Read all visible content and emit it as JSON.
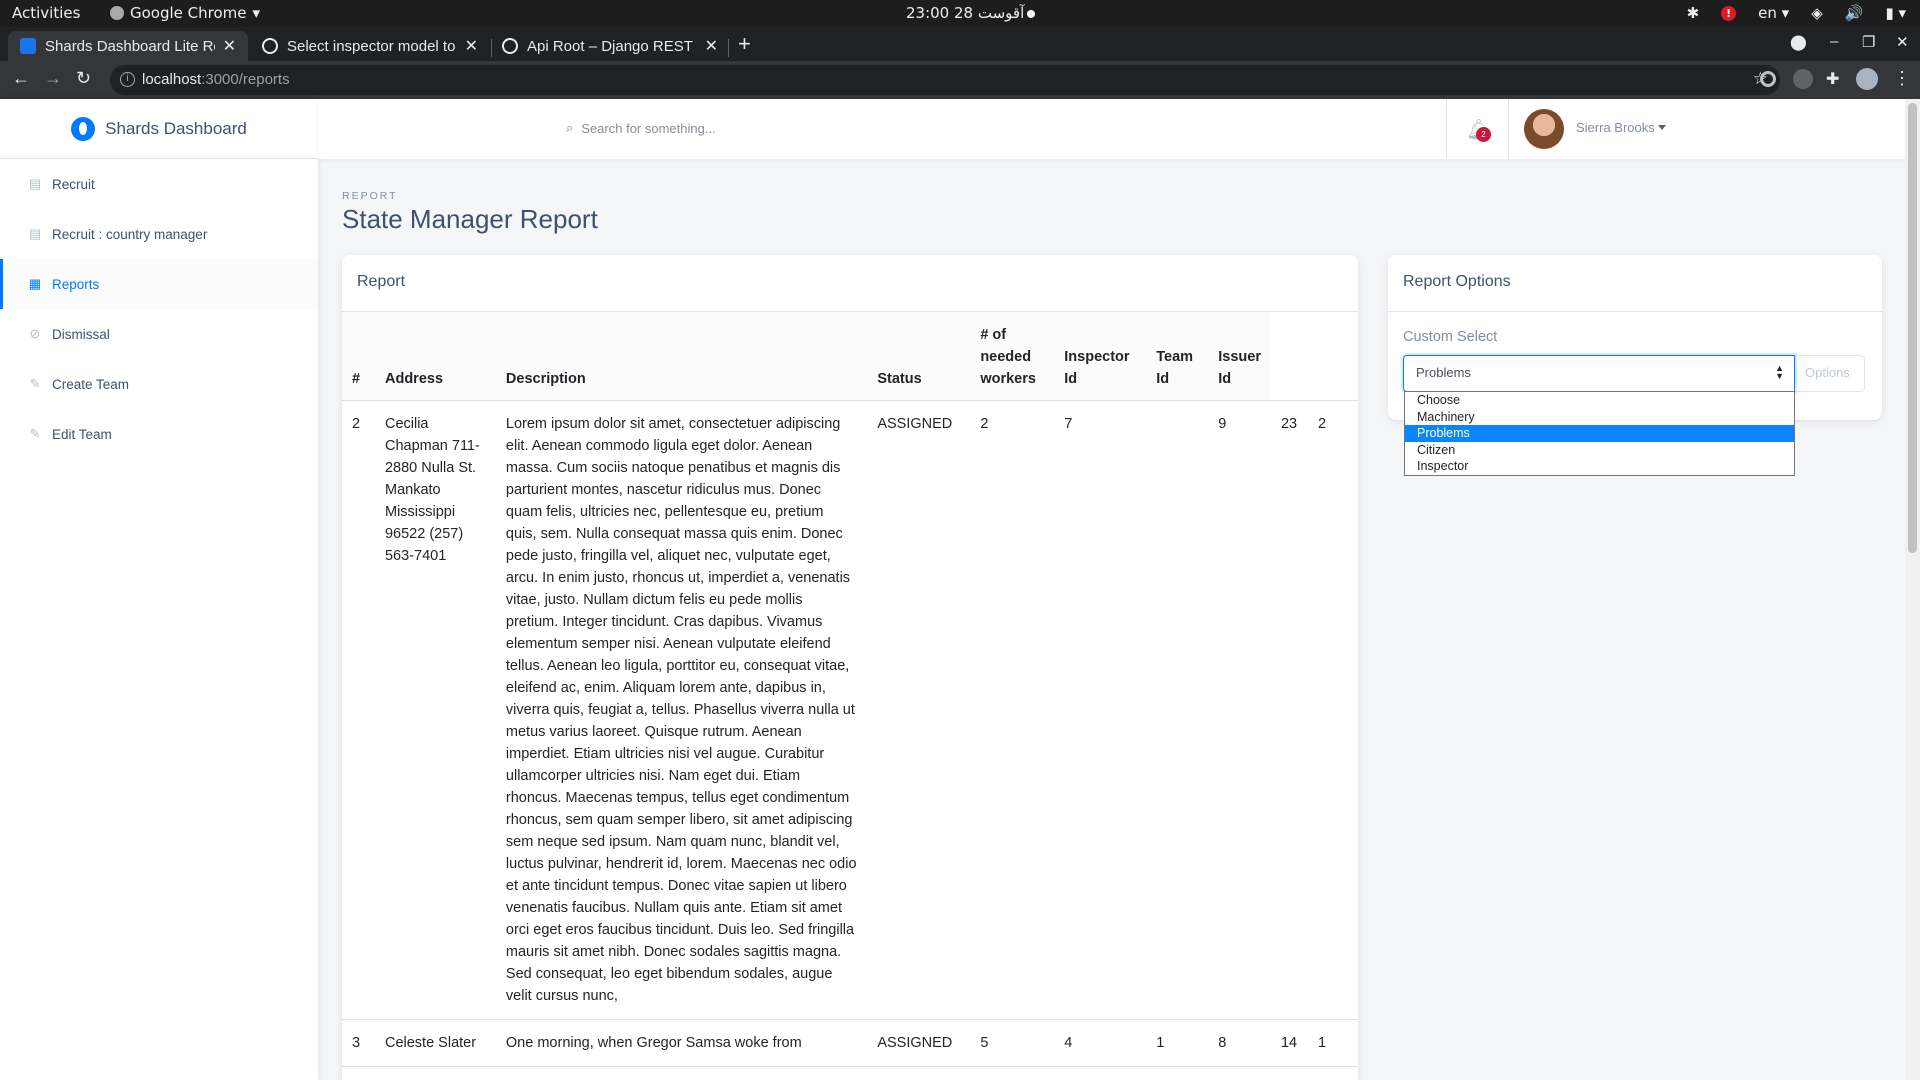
{
  "os": {
    "activities": "Activities",
    "app_name": "Google Chrome",
    "clock": "23:00  28 آقوست",
    "lang": "en"
  },
  "browser": {
    "tabs": [
      {
        "title": "Shards Dashboard Lite Re"
      },
      {
        "title": "Select inspector model to"
      },
      {
        "title": "Api Root – Django REST fr"
      }
    ],
    "url_host": "localhost",
    "url_path": ":3000/reports"
  },
  "sidebar": {
    "brand": "Shards Dashboard",
    "items": [
      {
        "label": "Recruit",
        "icon": "file-icon"
      },
      {
        "label": "Recruit : country manager",
        "icon": "file-icon"
      },
      {
        "label": "Reports",
        "icon": "grid-icon"
      },
      {
        "label": "Dismissal",
        "icon": "block-icon"
      },
      {
        "label": "Create Team",
        "icon": "pencil-icon"
      },
      {
        "label": "Edit Team",
        "icon": "pencil-icon"
      }
    ]
  },
  "topnav": {
    "search_placeholder": "Search for something...",
    "notifications": "2",
    "user_name": "Sierra Brooks"
  },
  "page": {
    "subtitle": "REPORT",
    "title": "State Manager Report"
  },
  "report": {
    "title": "Report",
    "columns": [
      "#",
      "Address",
      "Description",
      "Status",
      "# of needed workers",
      "Inspector Id",
      "Team Id",
      "Issuer Id",
      "",
      ""
    ],
    "rows": [
      {
        "num": "2",
        "address": "Cecilia Chapman 711-2880 Nulla St. Mankato Mississippi 96522 (257) 563-7401",
        "description": "Lorem ipsum dolor sit amet, consectetuer adipiscing elit. Aenean commodo ligula eget dolor. Aenean massa. Cum sociis natoque penatibus et magnis dis parturient montes, nascetur ridiculus mus. Donec quam felis, ultricies nec, pellentesque eu, pretium quis, sem. Nulla consequat massa quis enim. Donec pede justo, fringilla vel, aliquet nec, vulputate eget, arcu. In enim justo, rhoncus ut, imperdiet a, venenatis vitae, justo. Nullam dictum felis eu pede mollis pretium. Integer tincidunt. Cras dapibus. Vivamus elementum semper nisi. Aenean vulputate eleifend tellus. Aenean leo ligula, porttitor eu, consequat vitae, eleifend ac, enim. Aliquam lorem ante, dapibus in, viverra quis, feugiat a, tellus. Phasellus viverra nulla ut metus varius laoreet. Quisque rutrum. Aenean imperdiet. Etiam ultricies nisi vel augue. Curabitur ullamcorper ultricies nisi. Nam eget dui. Etiam rhoncus. Maecenas tempus, tellus eget condimentum rhoncus, sem quam semper libero, sit amet adipiscing sem neque sed ipsum. Nam quam nunc, blandit vel, luctus pulvinar, hendrerit id, lorem. Maecenas nec odio et ante tincidunt tempus. Donec vitae sapien ut libero venenatis faucibus. Nullam quis ante. Etiam sit amet orci eget eros faucibus tincidunt. Duis leo. Sed fringilla mauris sit amet nibh. Donec sodales sagittis magna. Sed consequat, leo eget bibendum sodales, augue velit cursus nunc,",
        "status": "ASSIGNED",
        "workers": "2",
        "inspector": "7",
        "team": "",
        "issuer": "9",
        "extra1": "23",
        "extra2": "2"
      },
      {
        "num": "3",
        "address": "Celeste Slater",
        "description": "One morning, when Gregor Samsa woke from",
        "status": "ASSIGNED",
        "workers": "5",
        "inspector": "4",
        "team": "1",
        "issuer": "8",
        "extra1": "14",
        "extra2": "1"
      }
    ]
  },
  "options": {
    "title": "Report Options",
    "label": "Custom Select",
    "selected": "Problems",
    "button": "Options",
    "dropdown": [
      "Choose",
      "Machinery",
      "Problems",
      "Citizen",
      "Inspector"
    ],
    "selected_index": 2
  }
}
